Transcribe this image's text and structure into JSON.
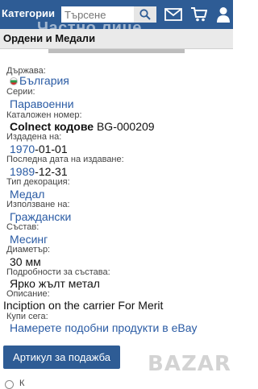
{
  "header": {
    "categories_label": "Категории",
    "search_placeholder": "Търсене",
    "watermark": "Частно лице"
  },
  "subheader": {
    "title": "Ордени и Медали"
  },
  "details": [
    {
      "label": "Държава:",
      "value": "България"
    },
    {
      "label": "Серии:",
      "value": "Паравоенни"
    },
    {
      "label": "Каталожен номер:",
      "value_bold": "Colnect кодове",
      "value": "BG-000209"
    },
    {
      "label": "Издадена на:",
      "value_link": "1970",
      "value": "-01-01"
    },
    {
      "label": "Последна дата на издаване:",
      "value_link": "1989",
      "value": "-12-31"
    },
    {
      "label": "Тип декорация:",
      "value": "Медал"
    },
    {
      "label": "Използване на:",
      "value": "Граждански"
    },
    {
      "label": "Състав:",
      "value": "Месинг"
    },
    {
      "label": "Диаметър:",
      "value": "30 мм"
    },
    {
      "label": "Подробности за състава:",
      "value": "Ярко жълт метал"
    },
    {
      "label": "Описание:",
      "value": "Inciption on the carrier For Merit"
    },
    {
      "label": "Купи сега:",
      "value": "Намерете подобни продукти в eBay"
    }
  ],
  "sale_button": "Артикул за подажба",
  "logo_text": "BAZAR",
  "bottom_text": "К"
}
